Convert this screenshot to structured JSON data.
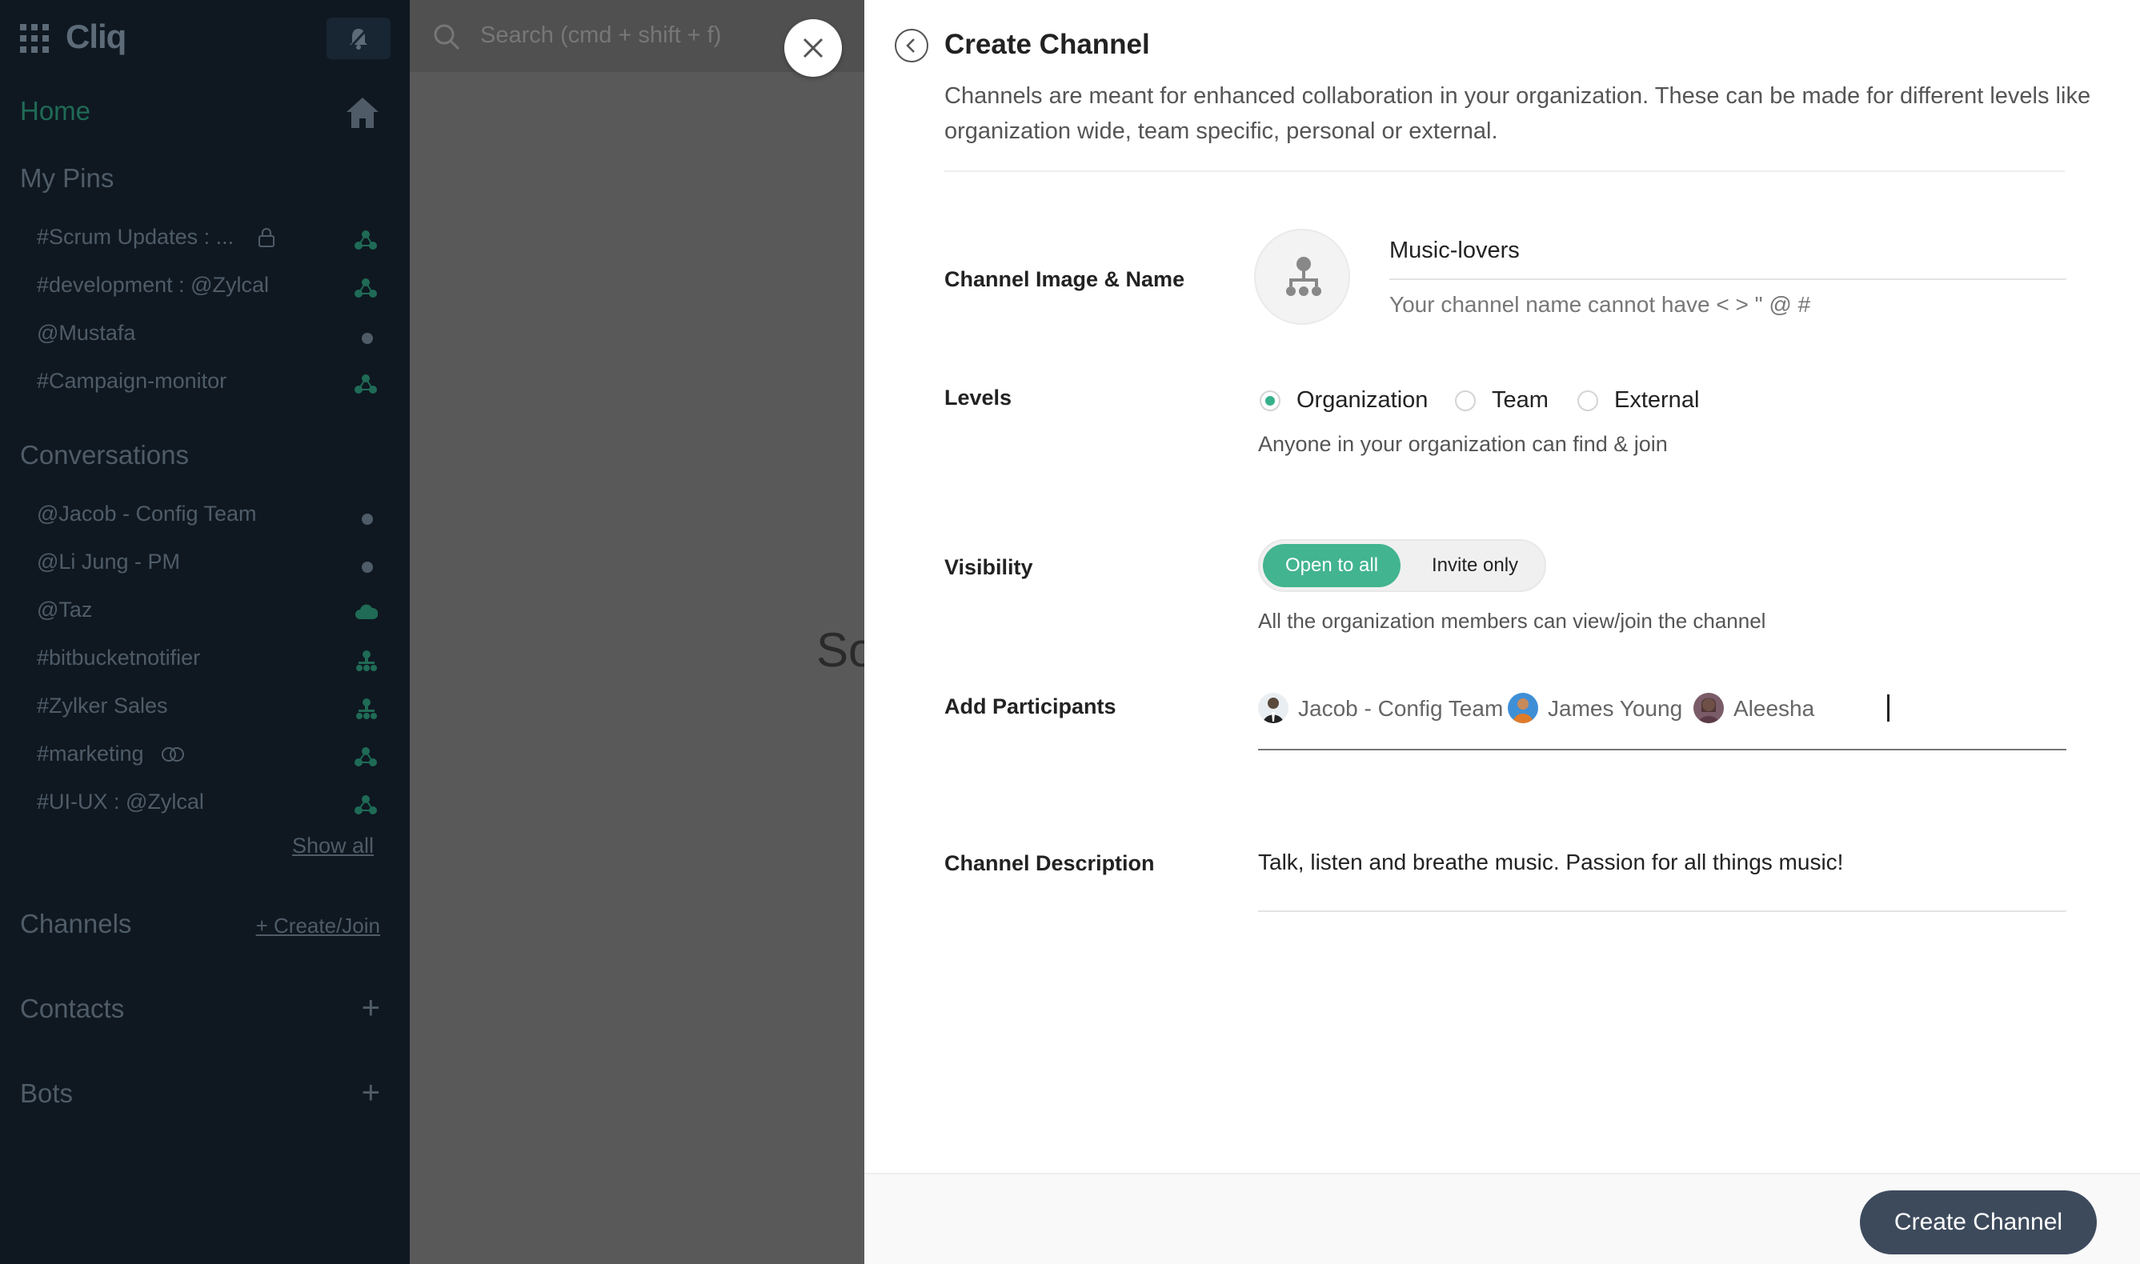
{
  "app": {
    "name": "Cliq"
  },
  "search": {
    "placeholder": "Search (cmd + shift + f)"
  },
  "sidebar": {
    "home_label": "Home",
    "pins_heading": "My Pins",
    "pins": [
      {
        "label": "#Scrum Updates : ...",
        "trailing_icon": "channel-org-icon",
        "lock": true
      },
      {
        "label": "#development : @Zylcal",
        "trailing_icon": "channel-org-icon"
      },
      {
        "label": "@Mustafa",
        "trailing_icon": "status-dot"
      },
      {
        "label": "#Campaign-monitor",
        "trailing_icon": "channel-org-icon"
      }
    ],
    "conversations_heading": "Conversations",
    "conversations": [
      {
        "label": "@Jacob - Config Team",
        "trailing_icon": "status-dot"
      },
      {
        "label": "@Li Jung - PM",
        "trailing_icon": "status-dot"
      },
      {
        "label": "@Taz",
        "trailing_icon": "cloud-icon"
      },
      {
        "label": "#bitbucketnotifier",
        "trailing_icon": "channel-team-icon"
      },
      {
        "label": "#Zylker Sales",
        "trailing_icon": "channel-team-icon"
      },
      {
        "label": "#marketing",
        "trailing_icon": "channel-org-icon",
        "link": true
      },
      {
        "label": "#UI-UX : @Zylcal",
        "trailing_icon": "channel-org-icon"
      }
    ],
    "show_all": "Show all",
    "channels_heading": "Channels",
    "channels_action": "+ Create/Join",
    "contacts_heading": "Contacts",
    "bots_heading": "Bots"
  },
  "main": {
    "partial_text": "So"
  },
  "panel": {
    "title": "Create Channel",
    "description": "Channels are meant for enhanced collaboration in your organization. These can be made for different levels like organization wide, team specific, personal or external.",
    "image_name_label": "Channel Image & Name",
    "channel_name": "Music-lovers",
    "channel_name_hint": "Your channel name cannot have < > \" @ #",
    "levels_label": "Levels",
    "levels": [
      {
        "label": "Organization",
        "selected": true
      },
      {
        "label": "Team",
        "selected": false
      },
      {
        "label": "External",
        "selected": false
      }
    ],
    "levels_hint": "Anyone in your organization can find & join",
    "visibility_label": "Visibility",
    "visibility_options": [
      "Open to all",
      "Invite only"
    ],
    "visibility_selected": "Open to all",
    "visibility_hint": "All the organization members can view/join the channel",
    "participants_label": "Add Participants",
    "participants": [
      {
        "name": "Jacob - Config Team"
      },
      {
        "name": "James Young"
      },
      {
        "name": "Aleesha"
      }
    ],
    "channel_description_label": "Channel Description",
    "channel_description": "Talk, listen and breathe music. Passion for all things music!",
    "create_button": "Create Channel"
  },
  "colors": {
    "accent": "#42b48f",
    "button": "#3d4a5c",
    "sidebar": "#0f1821"
  }
}
